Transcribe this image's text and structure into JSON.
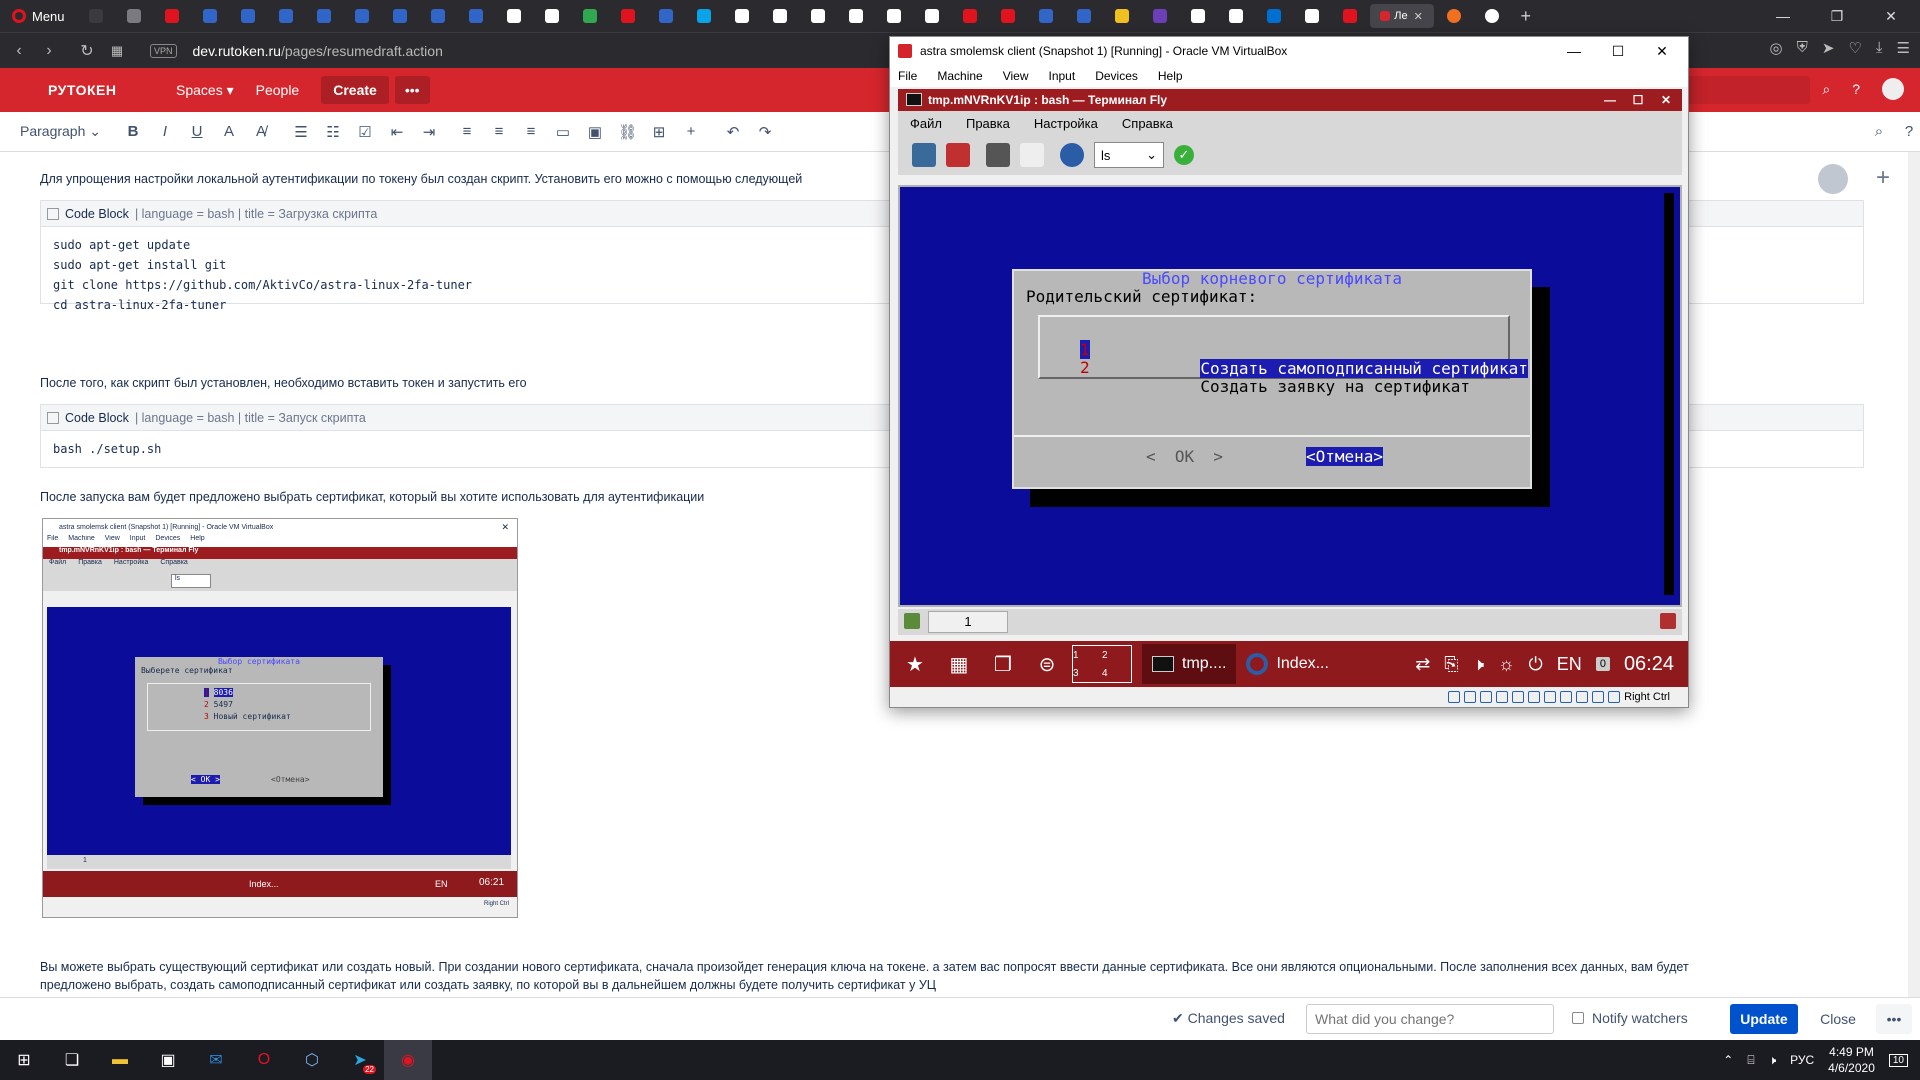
{
  "browser": {
    "menu_label": "Menu",
    "url_domain": "dev.rutoken.ru",
    "url_path": "/pages/resumedraft.action",
    "vpn_label": "VPN",
    "active_tab_label": "Ле",
    "tab_colors": [
      "#3a3a3f",
      "#7a7a80",
      "#e0141e",
      "#3166c8",
      "#3166c8",
      "#3166c8",
      "#3166c8",
      "#3166c8",
      "#3166c8",
      "#3166c8",
      "#3166c8",
      "#ffffff",
      "#ffffff",
      "#2fa84f",
      "#e0141e",
      "#3166c8",
      "#0ba3e8",
      "#ffffff",
      "#ffffff",
      "#ffffff",
      "#ffffff",
      "#ffffff",
      "#ffffff",
      "#e0141e",
      "#e0141e",
      "#3166c8",
      "#3166c8",
      "#f0c020",
      "#6a3fb8",
      "#ffffff",
      "#ffffff",
      "#0070d0",
      "#ffffff",
      "#e0141e"
    ]
  },
  "conf_header": {
    "logo": "РУТОКЕН",
    "spaces": "Spaces",
    "people": "People",
    "create": "Create",
    "more": "•••"
  },
  "toolbar": {
    "paragraph": "Paragraph"
  },
  "editor": {
    "p1": "Для упрощения настройки локальной аутентификации по токену был создан скрипт. Установить его можно с помощью следующей",
    "code1_title": "Code Block",
    "code1_meta": "| language = bash | title = Загрузка скрипта",
    "code1_lines": [
      "sudo apt-get update",
      "sudo apt-get install git",
      "git clone https://github.com/AktivCo/astra-linux-2fa-tuner",
      "cd astra-linux-2fa-tuner"
    ],
    "p2": "После того, как скрипт был установлен, необходимо вставить токен и запустить его",
    "code2_title": "Code Block",
    "code2_meta": "| language = bash | title = Запуск скрипта",
    "code2_lines": [
      "bash ./setup.sh"
    ],
    "p3": "После запуска вам будет предложено выбрать сертификат, который вы хотите использовать для аутентификации",
    "p4_line1": "Вы можете выбрать существующий сертификат или создать новый. При создании нового сертификата, сначала произойдет генерация ключа на токене. а затем вас попросят ввести данные сертификата. Все они являются опциональными. После заполнения всех данных, вам будет",
    "p4_line2": "предложено выбрать, создать самоподписанный сертификат или создать заявку, по которой вы в дальнейшем должны будете получить сертификат у УЦ"
  },
  "thumb": {
    "vbox_title": "astra smolemsk client (Snapshot 1) [Running] - Oracle VM VirtualBox",
    "menu": [
      "File",
      "Machine",
      "View",
      "Input",
      "Devices",
      "Help"
    ],
    "fly_title": "tmp.mNVRnKV1ip : bash — Терминал Fly",
    "fly_menu": [
      "Файл",
      "Правка",
      "Настройка",
      "Справка"
    ],
    "ls": "ls",
    "dlg_title": "Выбор сертификата",
    "dlg_prompt": "Выберете сертификат",
    "items": [
      {
        "num": "1",
        "text": "8036"
      },
      {
        "num": "2",
        "text": "5497"
      },
      {
        "num": "3",
        "text": "Новый сертификат"
      }
    ],
    "ok": "< OK >",
    "cancel": "<Отмена>",
    "tab_num": "1",
    "index_label": "Index...",
    "lang": "EN",
    "clock": "06:21",
    "right_ctrl": "Right Ctrl"
  },
  "savebar": {
    "changes_saved": "Changes saved",
    "change_placeholder": "What did you change?",
    "notify": "Notify watchers",
    "update": "Update",
    "close": "Close",
    "more": "•••"
  },
  "taskbar": {
    "lang": "РУС",
    "time": "4:49 PM",
    "date": "4/6/2020",
    "notif_count": "10",
    "telegram_badge": "22"
  },
  "vbox": {
    "title": "astra smolemsk client (Snapshot 1) [Running] - Oracle VM VirtualBox",
    "menu": [
      "File",
      "Machine",
      "View",
      "Input",
      "Devices",
      "Help"
    ],
    "right_ctrl": "Right Ctrl"
  },
  "fly": {
    "title": "tmp.mNVRnKV1ip : bash — Терминал Fly",
    "menu": [
      "Файл",
      "Правка",
      "Настройка",
      "Справка"
    ],
    "ls": "ls",
    "tab_num": "1",
    "task_term": "tmp....",
    "task_index": "Index...",
    "desk": [
      "1",
      "2",
      "3",
      "4"
    ],
    "lang": "EN",
    "kbd": "0",
    "clock": "06:24"
  },
  "dialog": {
    "title": "Выбор корневого сертификата",
    "prompt": "Родительский сертификат:",
    "item1_num": "1",
    "item1_text": "Создать самоподписанный сертификат",
    "item2_num": "2",
    "item2_text": "Создать заявку на сертификат",
    "ok": "<  OK  >",
    "cancel": "<Отмена>"
  }
}
